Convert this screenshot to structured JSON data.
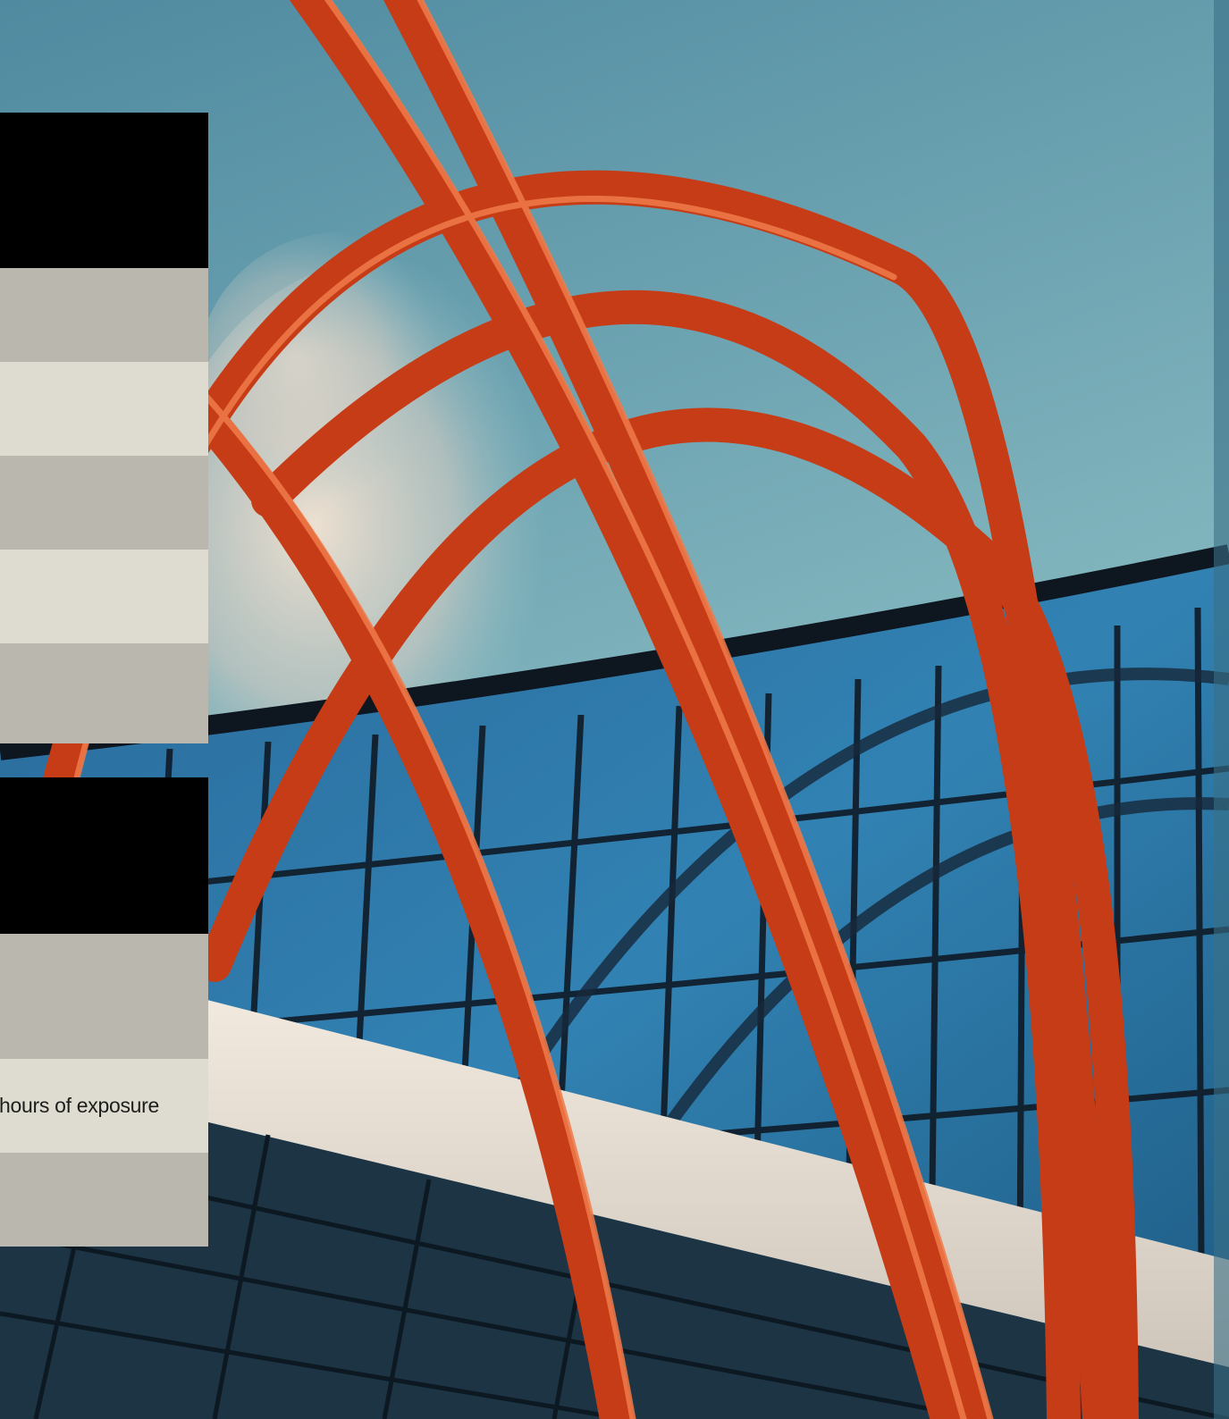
{
  "colors": {
    "sky_top": "#4d8aa0",
    "sky_bottom": "#7fb4bf",
    "arch": "#d8471f",
    "arch_highlight": "#f07b4a",
    "glass": "#2c76a6",
    "glass_frame": "#0f1a26",
    "beam": "#ece4d9",
    "panel_black": "#000000",
    "panel_grey": "#b9b7ae",
    "panel_cream": "#dedcd0"
  },
  "photo": {
    "subject": "orange-arches-over-glass-facade"
  },
  "sidebar": {
    "caption": "hours of exposure"
  }
}
